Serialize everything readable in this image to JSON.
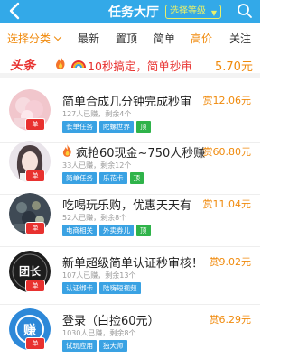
{
  "header": {
    "title": "任务大厅",
    "level_button": "选择等级",
    "level_arrow": "▼"
  },
  "filters": [
    "选择分类",
    "最新",
    "置顶",
    "简单",
    "高价",
    "关注"
  ],
  "headline": {
    "tag": "头条",
    "text_prefix": "10秒搞定，简单秒审",
    "price": "5.70元"
  },
  "tasks": [
    {
      "title": "简单合成几分钟完成秒审",
      "reward": "赏12.06元",
      "meta": "127人已赚，剩余4个",
      "tags": [
        "长单任务",
        "陀螺世界",
        "顶"
      ],
      "badge": "单"
    },
    {
      "title": "疯抢60现金~750人秒赚",
      "reward": "赏60.80元",
      "meta": "33人已赚，剩余12个",
      "tags": [
        "简单任务",
        "乐花卡",
        "顶"
      ],
      "badge": "单"
    },
    {
      "title": "吃喝玩乐购，优惠天天有",
      "reward": "赏11.04元",
      "meta": "52人已赚，剩余8个",
      "tags": [
        "电商相关",
        "外卖券儿",
        "顶"
      ],
      "badge": "单"
    },
    {
      "title": "新单超级简单认证秒审核！",
      "reward": "赏9.02元",
      "meta": "107人已赚，剩余13个",
      "tags": [
        "认证绑卡",
        "陆嗨短视频"
      ],
      "badge": "单",
      "avatar_text": "团长"
    },
    {
      "title": "登录（白捡60元）",
      "reward": "赏6.29元",
      "meta": "1030人已赚，剩余8个",
      "tags": [
        "试玩应用",
        "独大师"
      ],
      "badge": "单",
      "avatar_text": "赚"
    }
  ]
}
